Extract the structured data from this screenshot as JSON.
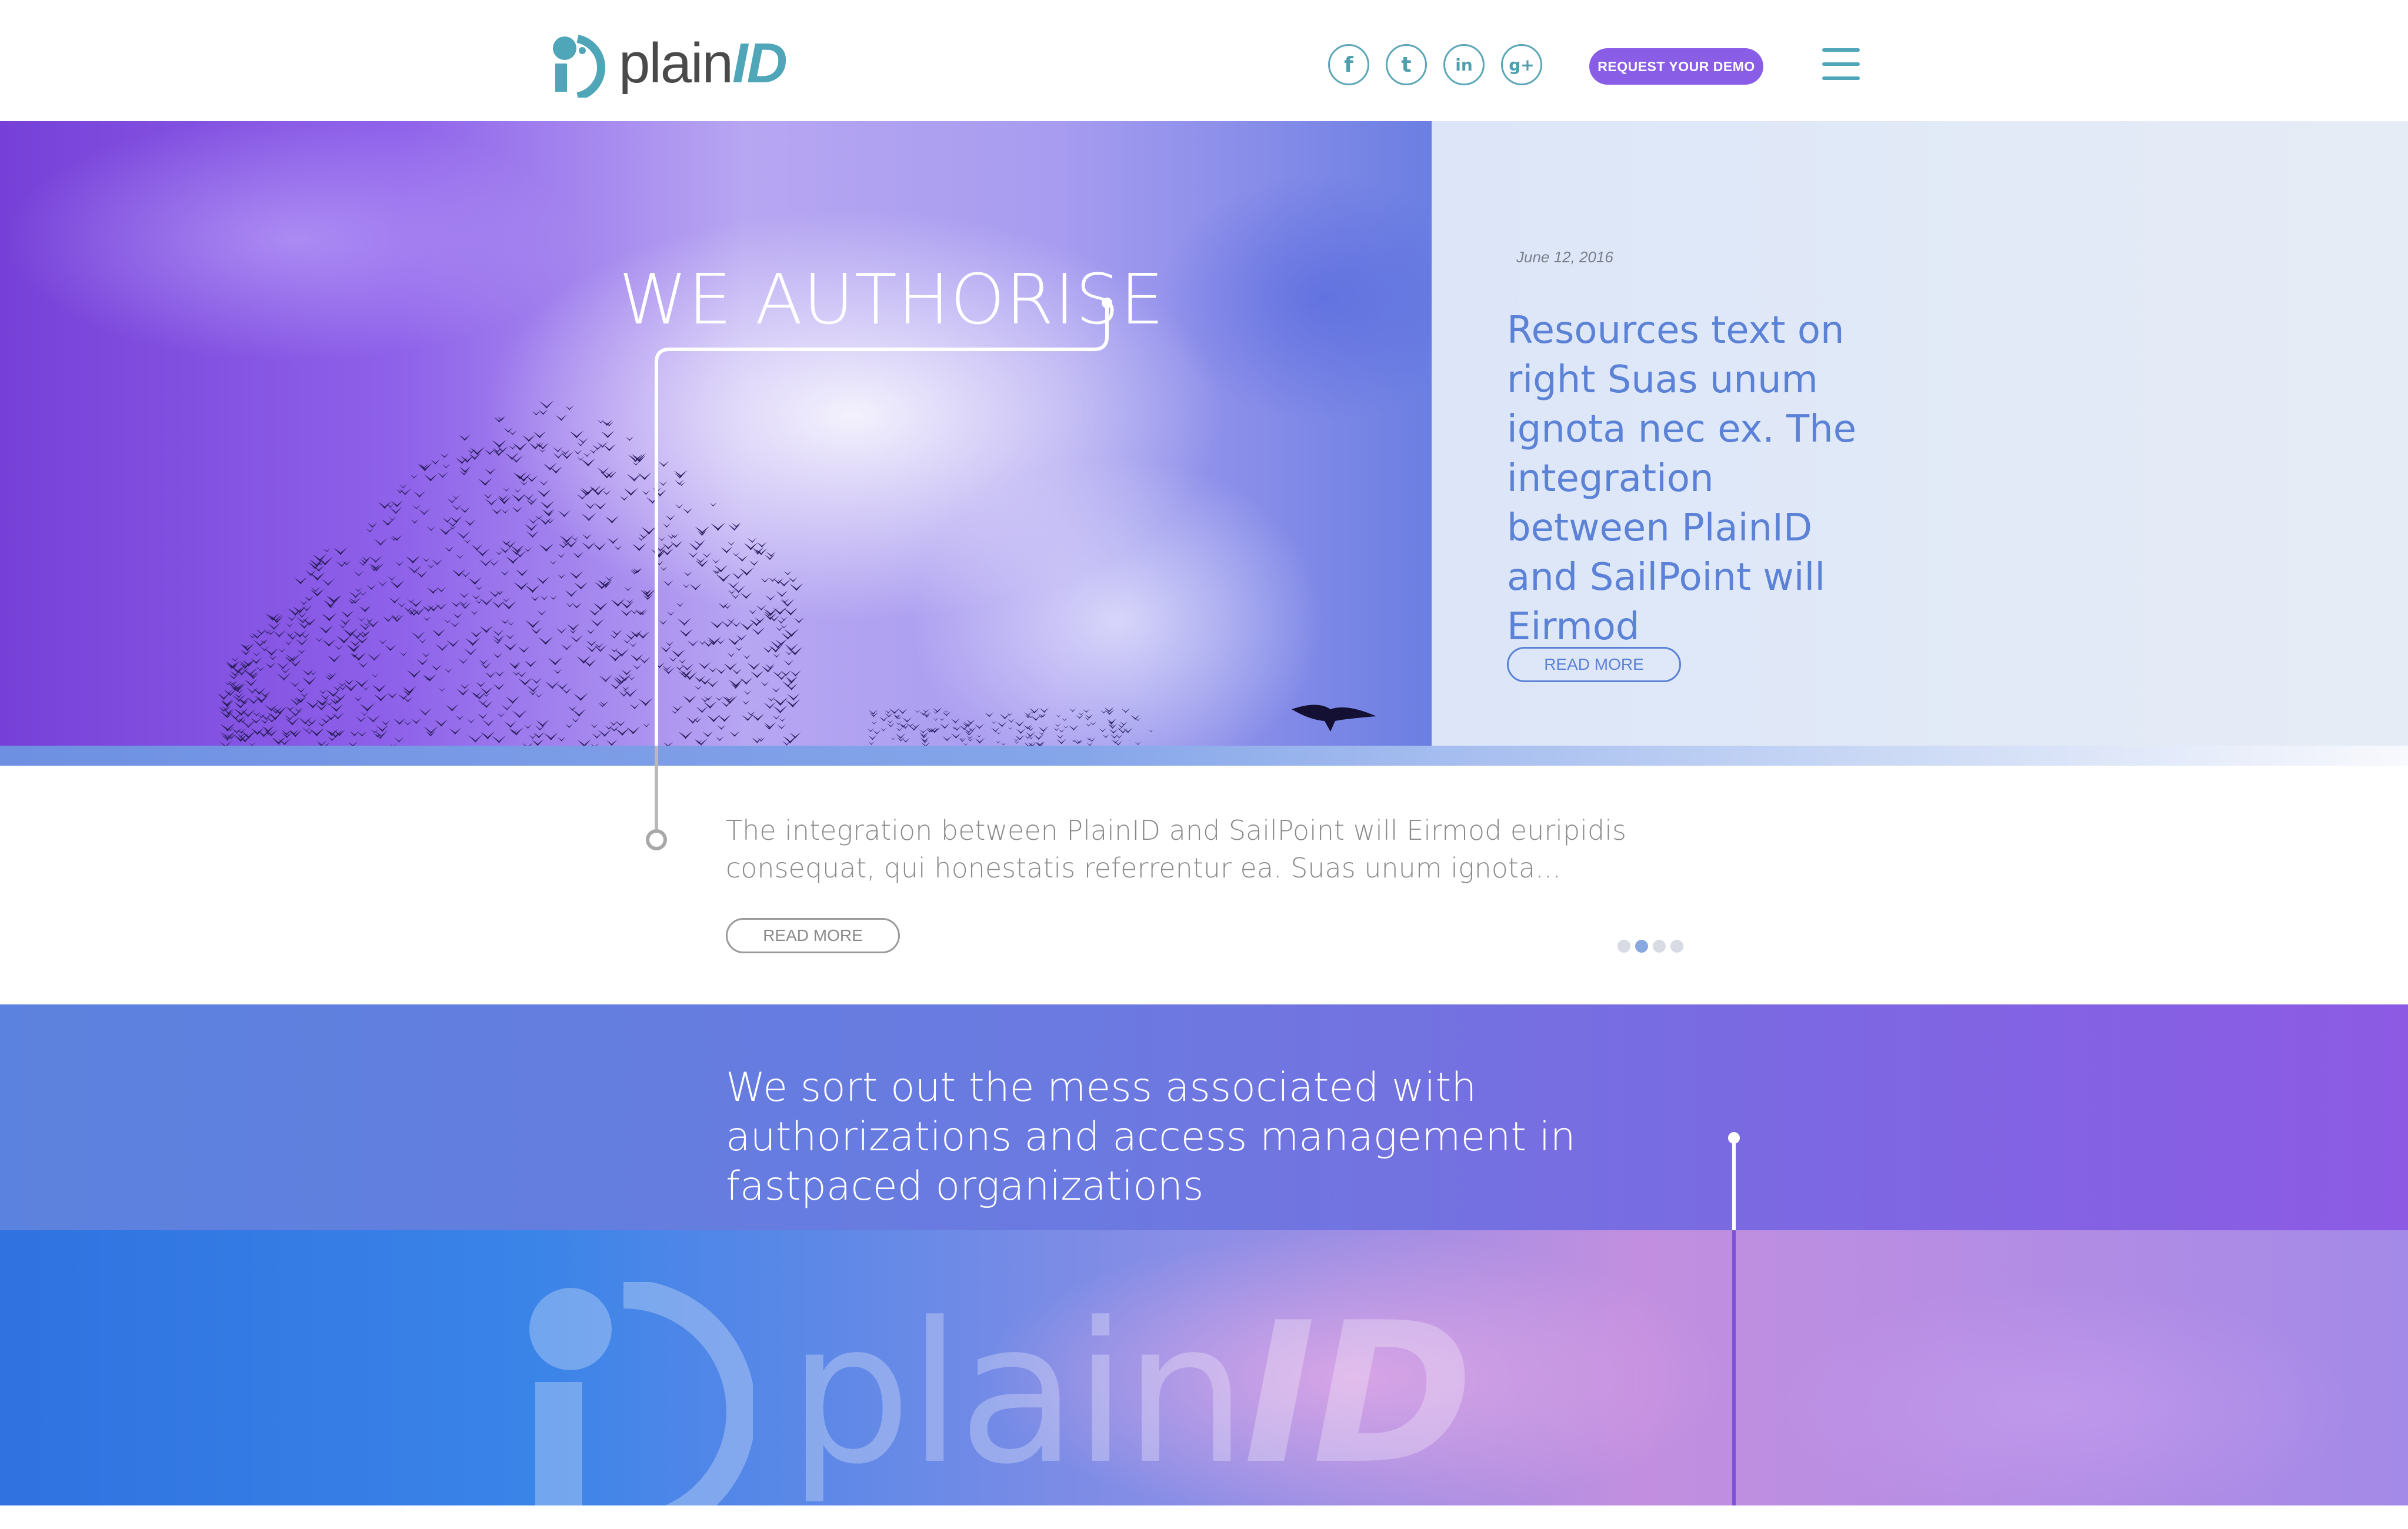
{
  "brand": {
    "logo_text": "plain",
    "logo_text_id": "ID",
    "colors": {
      "teal": "#4fa6b8",
      "purple": "#8a5de6",
      "blue": "#5b82d6"
    }
  },
  "header": {
    "social": [
      {
        "icon": "facebook-icon",
        "glyph": "f"
      },
      {
        "icon": "twitter-icon",
        "glyph": "t"
      },
      {
        "icon": "linkedin-icon",
        "glyph": "in"
      },
      {
        "icon": "google-plus-icon",
        "glyph": "g+"
      }
    ],
    "demo_button": "REQUEST YOUR DEMO",
    "menu_icon": "hamburger-menu-icon"
  },
  "hero": {
    "title": "WE AUTHORISE"
  },
  "featured_article": {
    "date": "June 12, 2016",
    "title": "Resources text on right Suas unum ignota nec ex. The integration between PlainID and SailPoint will Eirmod",
    "read_more": "READ MORE"
  },
  "intro": {
    "text": "The integration between PlainID and SailPoint will Eirmod euripidis consequat, qui honestatis referrentur ea. Suas unum ignota...",
    "read_more": "READ MORE",
    "carousel": {
      "count": 4,
      "active_index": 1
    }
  },
  "mission": {
    "text": "We sort out the mess associated with authorizations and access management in fastpaced organizations"
  }
}
